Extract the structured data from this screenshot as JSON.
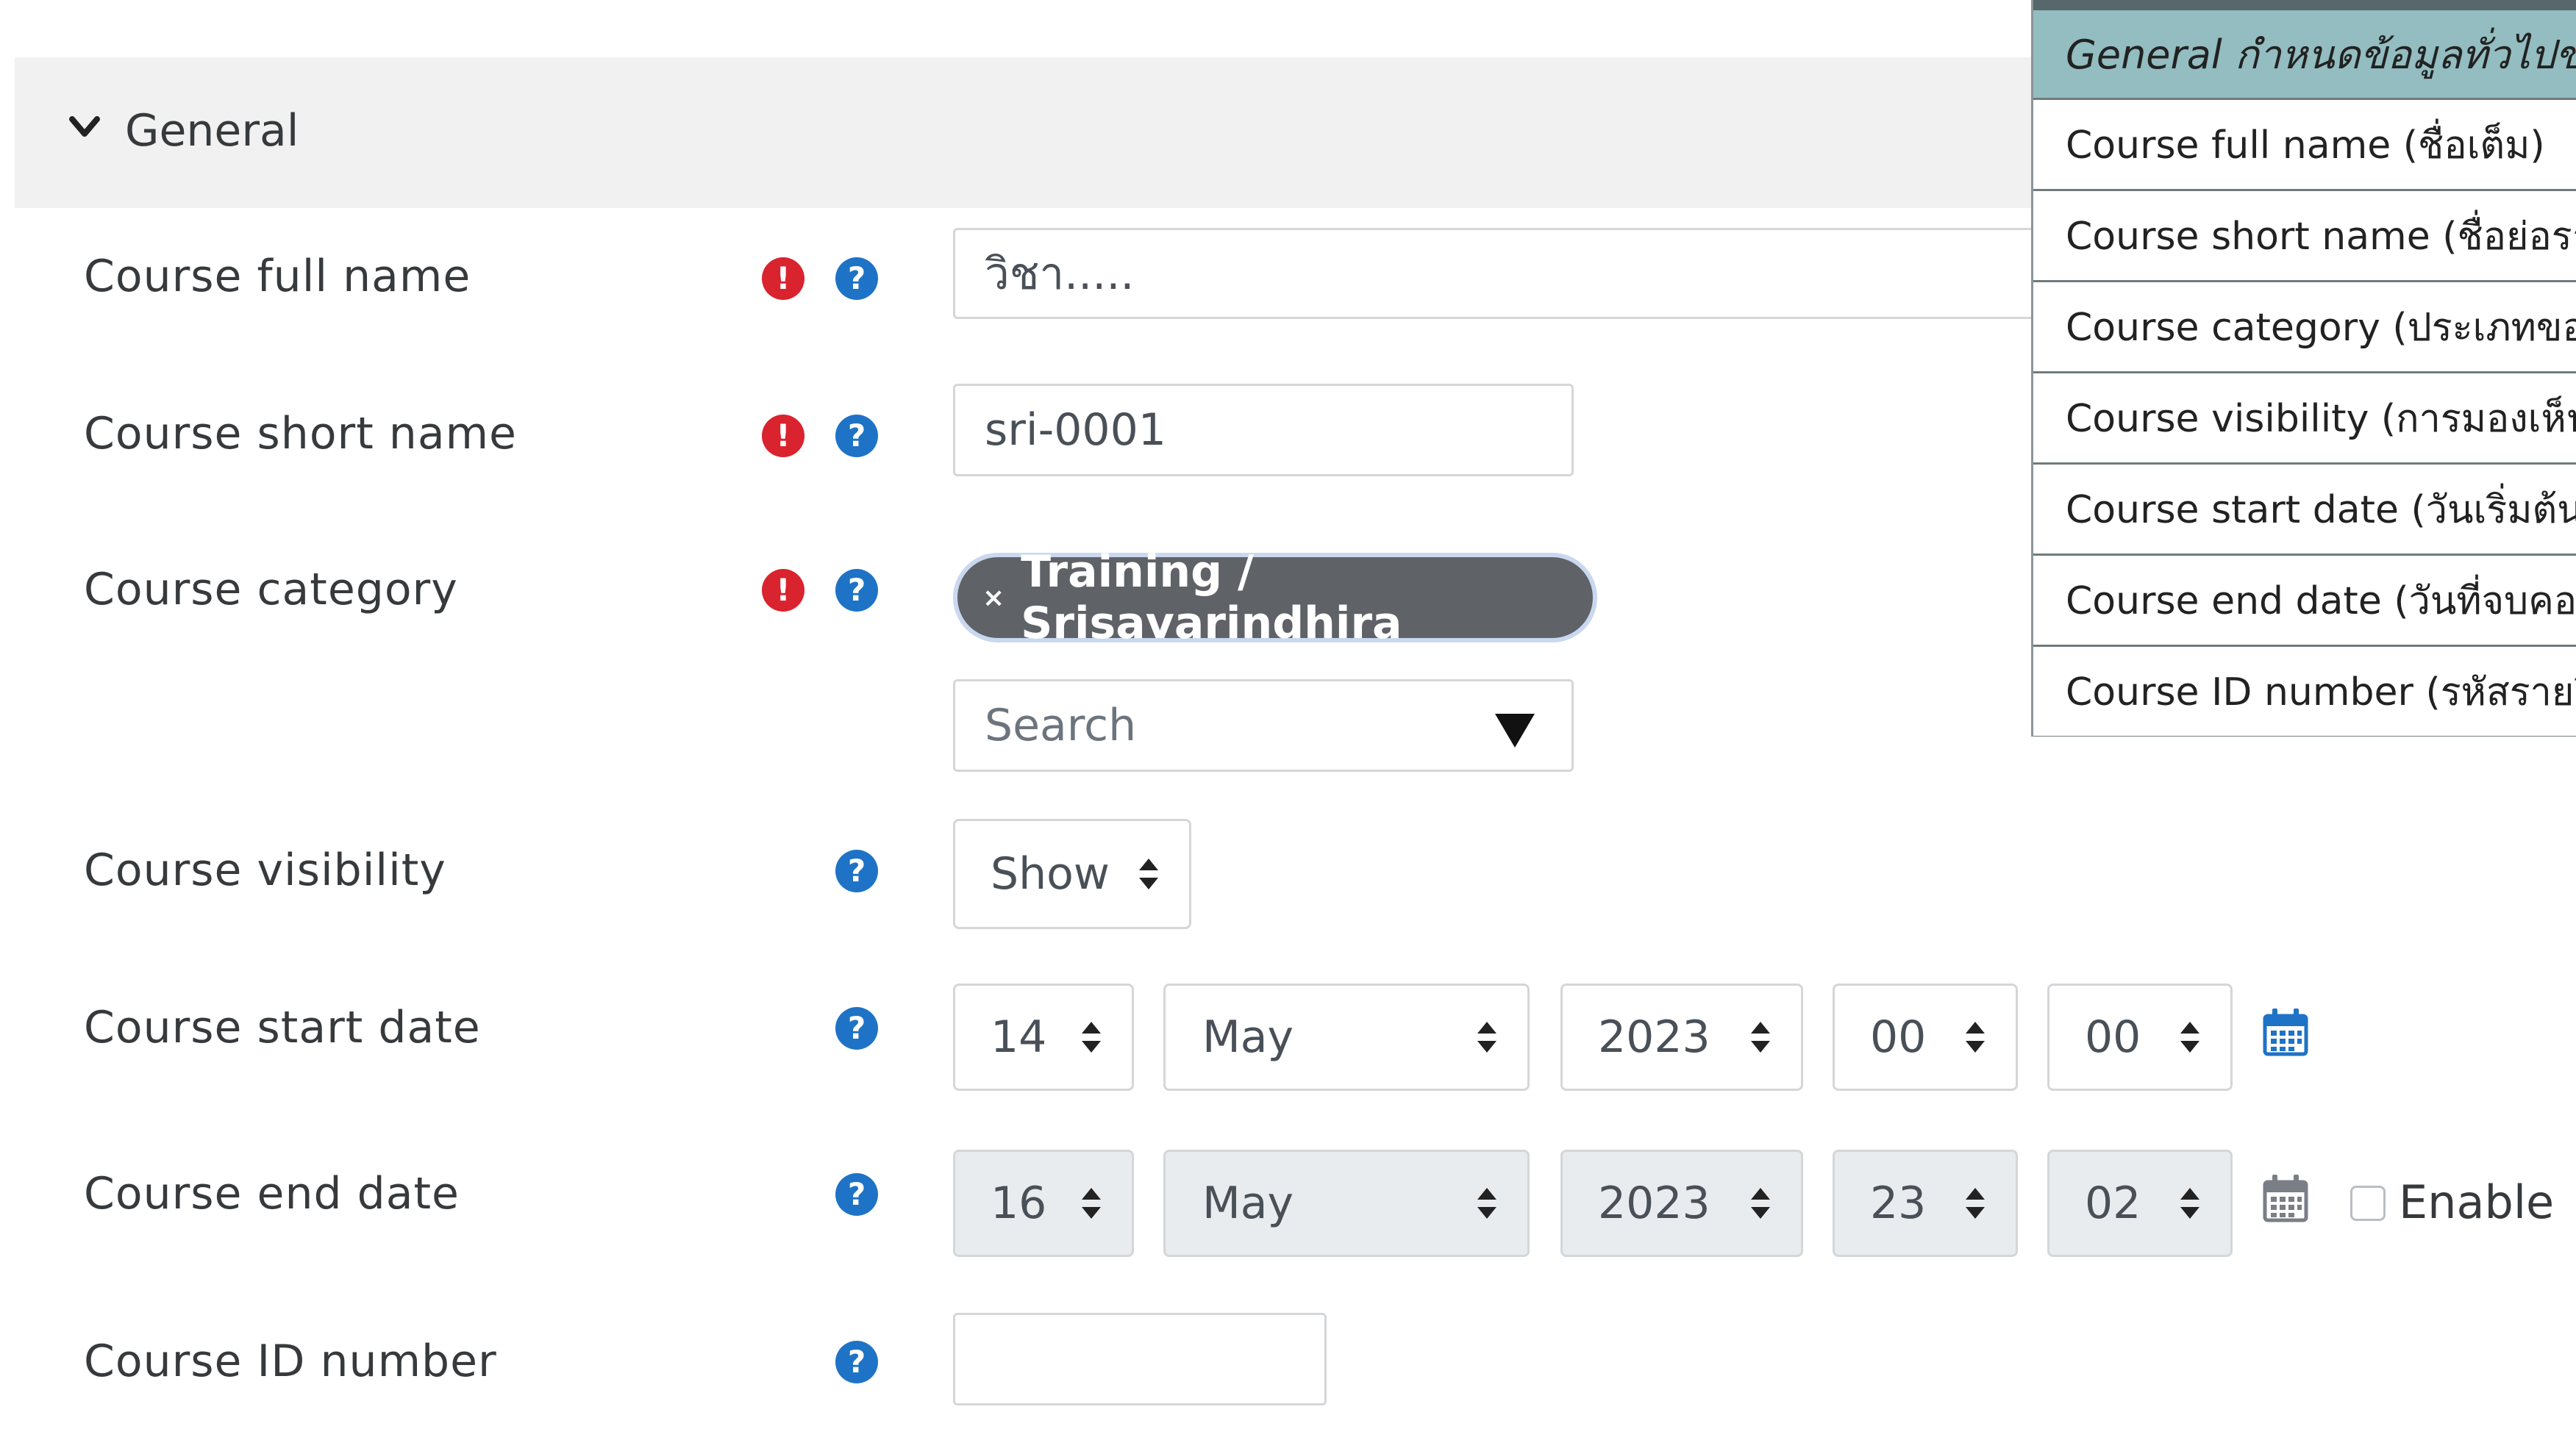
{
  "general": {
    "title": "General"
  },
  "fields": {
    "full_name": {
      "label": "Course full name",
      "value": "วิชา....."
    },
    "short_name": {
      "label": "Course short name",
      "value": "sri-0001"
    },
    "category": {
      "label": "Course category",
      "selected": "Training / Srisavarindhira",
      "remove_glyph": "×",
      "search_placeholder": "Search"
    },
    "visibility": {
      "label": "Course visibility",
      "value": "Show"
    },
    "start_date": {
      "label": "Course start date",
      "day": "14",
      "month": "May",
      "year": "2023",
      "hour": "00",
      "minute": "00"
    },
    "end_date": {
      "label": "Course end date",
      "day": "16",
      "month": "May",
      "year": "2023",
      "hour": "23",
      "minute": "02",
      "enable_label": "Enable"
    },
    "id_number": {
      "label": "Course ID number",
      "value": ""
    }
  },
  "icons": {
    "required": "!",
    "help": "?"
  },
  "overlay": {
    "header": "General กำหนดข้อมูลทั่วไปของ",
    "rows": [
      "Course full name (ชื่อเต็ม)",
      "Course short name (ชื่อย่อรายวิ",
      "Course category (ประเภทของรา",
      "Course visibility (การมองเห็นราย",
      "Course start date (วันเริ่มต้นราย",
      "Course end date (วันที่จบคอร์ส)",
      "Course ID number (รหัสรายวิชา"
    ]
  },
  "colors": {
    "required": "#d9232e",
    "help": "#1e73c6",
    "badge": "#5f6368",
    "overlay_header": "#93bdc0"
  }
}
